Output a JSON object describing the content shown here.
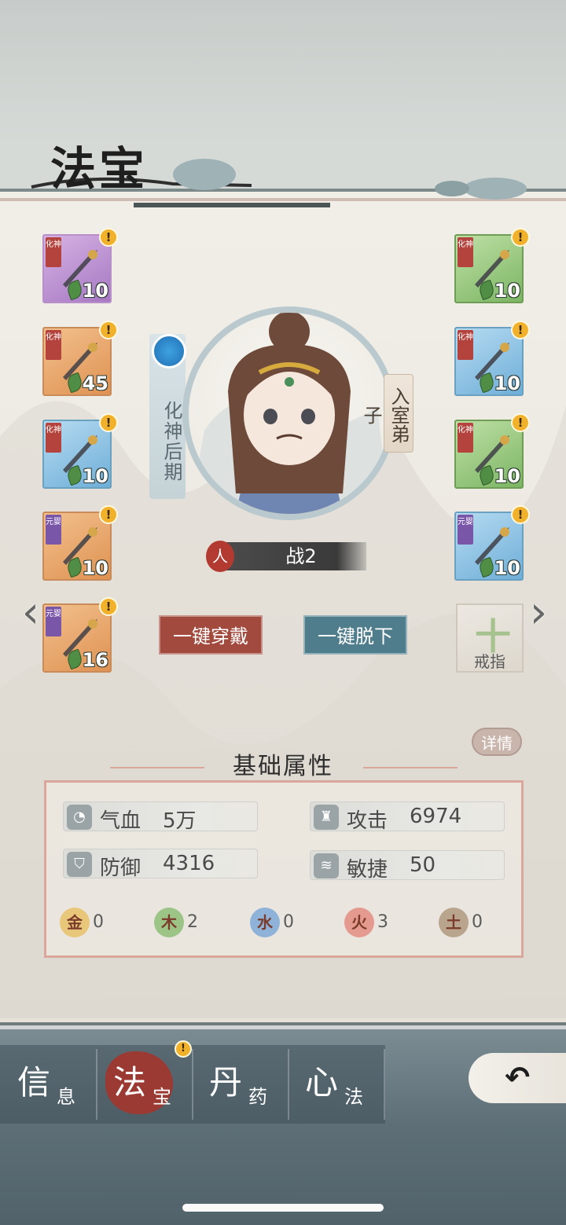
{
  "page": {
    "title": "法宝"
  },
  "left_slots": [
    {
      "tier": "化神",
      "level": "10",
      "color": "purple",
      "icon": "sword-icon"
    },
    {
      "tier": "化神",
      "level": "45",
      "color": "orange",
      "icon": "dagger-icon"
    },
    {
      "tier": "化神",
      "level": "10",
      "color": "blue",
      "icon": "blade-icon"
    },
    {
      "tier": "元婴",
      "level": "10",
      "color": "orange",
      "icon": "robe-icon"
    },
    {
      "tier": "元婴",
      "level": "16",
      "color": "orange",
      "icon": "boots-icon"
    }
  ],
  "right_slots": [
    {
      "tier": "化神",
      "level": "10",
      "color": "green",
      "icon": "hairpin-icon"
    },
    {
      "tier": "化神",
      "level": "10",
      "color": "blue",
      "icon": "necklace-icon"
    },
    {
      "tier": "化神",
      "level": "10",
      "color": "green",
      "icon": "armguard-icon"
    },
    {
      "tier": "元婴",
      "level": "10",
      "color": "blue",
      "icon": "crown-icon"
    }
  ],
  "alert_symbol": "!",
  "character": {
    "realm": "化神后期",
    "rank": "入室弟子",
    "power_icon": "人",
    "power": "战2"
  },
  "buttons": {
    "equip_all": "一键穿戴",
    "unequip_all": "一键脱下"
  },
  "ring_slot": {
    "plus": "十",
    "label": "戒指"
  },
  "attributes": {
    "title": "基础属性",
    "details": "详情",
    "stats": [
      {
        "name": "气血",
        "value": "5万",
        "icon": "blood-icon"
      },
      {
        "name": "攻击",
        "value": "6974",
        "icon": "attack-icon"
      },
      {
        "name": "防御",
        "value": "4316",
        "icon": "shield-icon"
      },
      {
        "name": "敏捷",
        "value": "50",
        "icon": "wind-icon"
      }
    ],
    "elements": [
      {
        "glyph": "金",
        "count": "0",
        "color": "#e8c77a"
      },
      {
        "glyph": "木",
        "count": "2",
        "color": "#9cc487"
      },
      {
        "glyph": "水",
        "count": "0",
        "color": "#8fb2d8"
      },
      {
        "glyph": "火",
        "count": "3",
        "color": "#e49a8e"
      },
      {
        "glyph": "土",
        "count": "0",
        "color": "#b9a58e"
      }
    ]
  },
  "nav": [
    {
      "big": "信",
      "small": "息"
    },
    {
      "big": "法",
      "small": "宝"
    },
    {
      "big": "丹",
      "small": "药"
    },
    {
      "big": "心",
      "small": "法"
    }
  ],
  "back": "↶"
}
